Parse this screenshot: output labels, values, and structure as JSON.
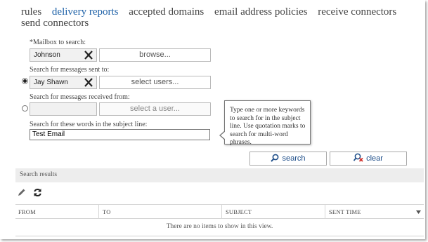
{
  "nav": {
    "tabs": [
      {
        "label": "rules",
        "active": false
      },
      {
        "label": "delivery reports",
        "active": true
      },
      {
        "label": "accepted domains",
        "active": false
      },
      {
        "label": "email address policies",
        "active": false
      },
      {
        "label": "receive connectors",
        "active": false
      },
      {
        "label": "send connectors",
        "active": false
      }
    ]
  },
  "form": {
    "mailbox_label": "*Mailbox to search:",
    "mailbox_value": "Johnson",
    "browse_label": "browse...",
    "sent_to_label": "Search for messages sent to:",
    "sent_to_value": "Jay Shawn",
    "select_users_label": "select users...",
    "received_from_label": "Search for messages received from:",
    "received_from_value": "",
    "select_user_label": "select a user...",
    "subject_label": "Search for these words in the subject line:",
    "subject_value": "Test Email",
    "selected_radio": "sent_to"
  },
  "tooltip": {
    "text": "Type one or more keywords to search for in the subject line. Use quotation marks to search for multi-word phrases."
  },
  "actions": {
    "search_label": "search",
    "clear_label": "clear"
  },
  "results": {
    "header": "Search results",
    "columns": [
      "FROM",
      "TO",
      "SUBJECT",
      "SENT TIME"
    ],
    "empty_message": "There are no items to show in this view."
  },
  "colors": {
    "accent": "#1f62a8",
    "header_bg": "#ededed"
  }
}
